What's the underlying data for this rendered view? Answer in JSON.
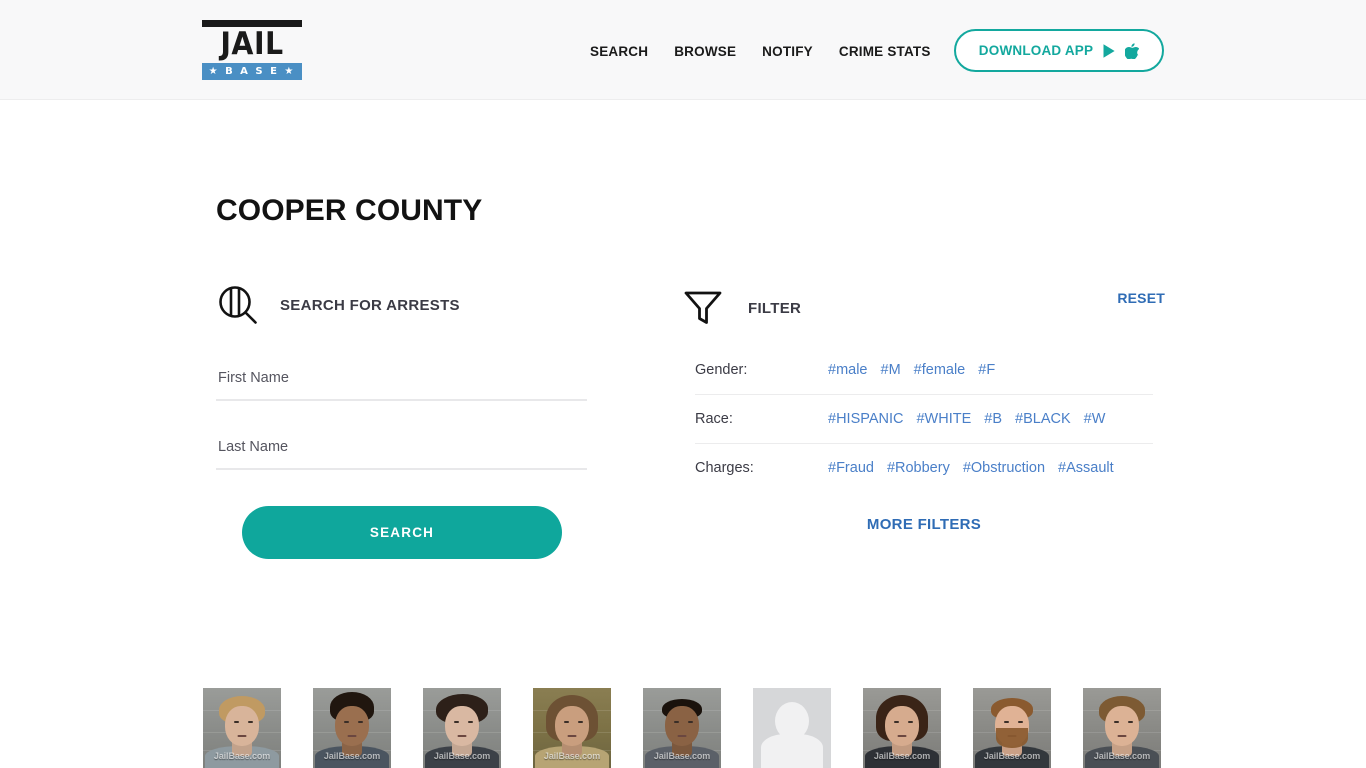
{
  "header": {
    "logo": {
      "top_word": "JAIL",
      "bottom_word": "★ B A S E ★",
      "brand_blue": "#4a8fc4"
    },
    "nav": [
      {
        "label": "SEARCH"
      },
      {
        "label": "BROWSE"
      },
      {
        "label": "NOTIFY"
      },
      {
        "label": "CRIME STATS"
      }
    ],
    "download_button": {
      "label": "DOWNLOAD APP",
      "icons": [
        "google-play-icon",
        "apple-icon"
      ],
      "accent": "#13a89e"
    }
  },
  "page": {
    "title": "COOPER COUNTY"
  },
  "search_panel": {
    "icon": "jail-search-icon",
    "title": "SEARCH FOR ARRESTS",
    "first_name": {
      "value": "",
      "placeholder": "First Name"
    },
    "last_name": {
      "value": "",
      "placeholder": "Last Name"
    },
    "submit_label": "SEARCH",
    "submit_color": "#0fa79c"
  },
  "filter_panel": {
    "icon": "funnel-icon",
    "title": "FILTER",
    "reset_label": "RESET",
    "more_filters_label": "MORE FILTERS",
    "link_color": "#4a7fc8",
    "rows": [
      {
        "label": "Gender:",
        "tags": [
          "#male",
          "#M",
          "#female",
          "#F"
        ]
      },
      {
        "label": "Race:",
        "tags": [
          "#HISPANIC",
          "#WHITE",
          "#B",
          "#BLACK",
          "#W"
        ]
      },
      {
        "label": "Charges:",
        "tags": [
          "#Fraud",
          "#Robbery",
          "#Obstruction",
          "#Assault"
        ]
      }
    ]
  },
  "mugshots": {
    "watermark": "JailBase.com",
    "items": [
      {
        "type": "photo",
        "tone": "cool",
        "skin": "#d8b49a",
        "hair": "#c09a62",
        "shirt": "#8e9aa0",
        "hair_style": "medium"
      },
      {
        "type": "photo",
        "tone": "cool",
        "skin": "#9a6f4f",
        "hair": "#20160f",
        "shirt": "#4b5560",
        "hair_style": "tall"
      },
      {
        "type": "photo",
        "tone": "cool",
        "skin": "#d9b8a2",
        "hair": "#2d2019",
        "shirt": "#3c4148",
        "hair_style": "shaggy"
      },
      {
        "type": "photo",
        "tone": "warm",
        "skin": "#c99e7e",
        "hair": "#6d5134",
        "shirt": "#b7a474",
        "hair_style": "long"
      },
      {
        "type": "photo",
        "tone": "cool",
        "skin": "#8a6244",
        "hair": "#1a120c",
        "shirt": "#5b6068",
        "hair_style": "short"
      },
      {
        "type": "placeholder"
      },
      {
        "type": "photo",
        "tone": "gray",
        "skin": "#d6ab8e",
        "hair": "#3a2417",
        "shirt": "#2e3136",
        "hair_style": "long"
      },
      {
        "type": "photo",
        "tone": "gray",
        "skin": "#e0b295",
        "hair": "#8a5a2f",
        "shirt": "#33383d",
        "hair_style": "beard"
      },
      {
        "type": "photo",
        "tone": "gray",
        "skin": "#dcb295",
        "hair": "#7d5a33",
        "shirt": "#4a4f55",
        "hair_style": "medium"
      }
    ]
  }
}
